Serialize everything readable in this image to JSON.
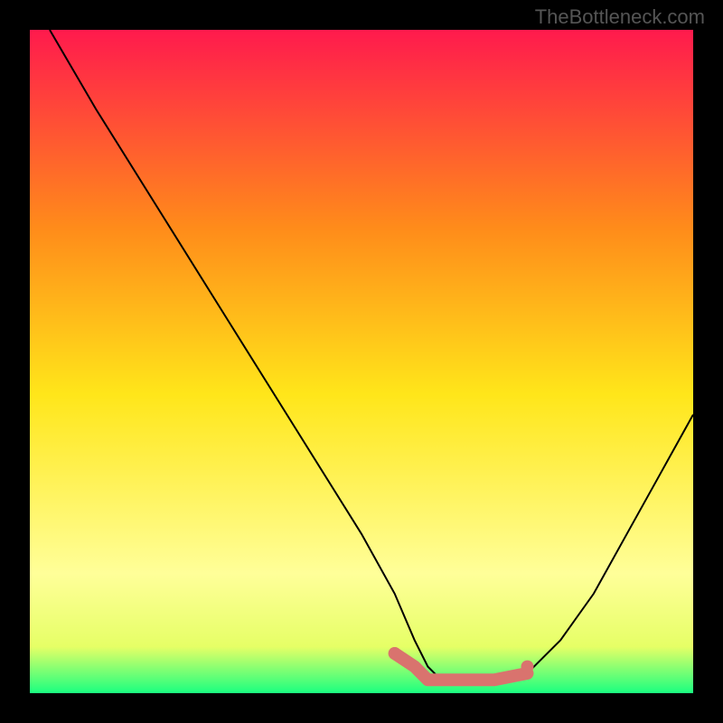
{
  "watermark": "TheBottleneck.com",
  "chart_data": {
    "type": "line",
    "title": "",
    "xlabel": "",
    "ylabel": "",
    "xlim": [
      0,
      100
    ],
    "ylim": [
      0,
      100
    ],
    "background_gradient": {
      "top": "#ff1a4d",
      "mid1": "#ff8c1a",
      "mid2": "#ffe61a",
      "mid3": "#e6ff66",
      "bottom": "#1aff80"
    },
    "series": [
      {
        "name": "curve",
        "color": "#000000",
        "stroke_width": 2,
        "x": [
          3,
          10,
          20,
          30,
          40,
          50,
          55,
          58,
          60,
          62,
          65,
          70,
          75,
          80,
          85,
          90,
          95,
          100
        ],
        "y": [
          100,
          88,
          72,
          56,
          40,
          24,
          15,
          8,
          4,
          2,
          2,
          2,
          3,
          8,
          15,
          24,
          33,
          42
        ]
      }
    ],
    "highlight_band": {
      "color": "#d9736e",
      "x": [
        55,
        58,
        60,
        62,
        65,
        70,
        75
      ],
      "y": [
        6,
        4,
        2,
        2,
        2,
        2,
        3
      ],
      "dots_x": [
        55,
        75
      ],
      "dots_y": [
        6,
        4
      ],
      "dot_radius": 7,
      "stroke_width": 14
    }
  }
}
